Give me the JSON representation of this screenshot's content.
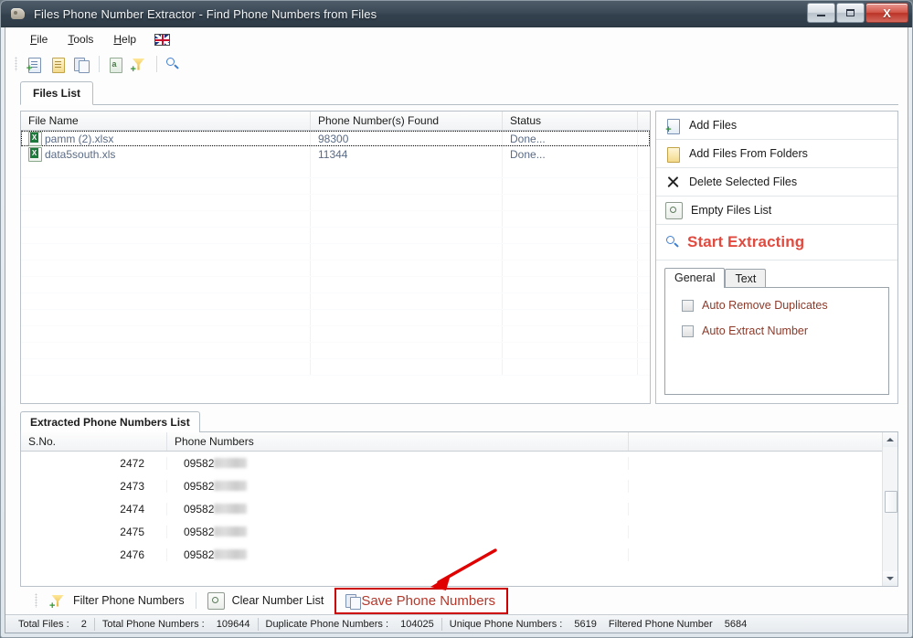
{
  "window": {
    "title": "Files Phone Number Extractor - Find Phone Numbers from Files",
    "minimize_label": "Minimize",
    "maximize_label": "Maximize",
    "close_label": "X"
  },
  "menu": {
    "items": [
      {
        "label": "File",
        "accel": "F"
      },
      {
        "label": "Tools",
        "accel": "T"
      },
      {
        "label": "Help",
        "accel": "H"
      }
    ],
    "language_icon": "uk-flag-icon"
  },
  "toolbar": {
    "buttons": [
      {
        "name": "add-files-icon",
        "tooltip": "Add Files"
      },
      {
        "name": "add-files-from-folders-icon",
        "tooltip": "Add Files From Folders"
      },
      {
        "name": "copy-icon",
        "tooltip": "Copy"
      },
      {
        "name": "extract-text-icon",
        "tooltip": "Extract Text"
      },
      {
        "name": "filter-icon",
        "tooltip": "Filter"
      },
      {
        "name": "search-icon",
        "tooltip": "Search"
      }
    ]
  },
  "files_tab": {
    "label": "Files List"
  },
  "files_grid": {
    "columns": [
      "File Name",
      "Phone Number(s) Found",
      "Status",
      ""
    ],
    "rows": [
      {
        "file_name": "pamm (2).xlsx",
        "found": "98300",
        "status": "Done...",
        "extra": ""
      },
      {
        "file_name": "data5south.xls",
        "found": "11344",
        "status": "Done...",
        "extra": ""
      }
    ],
    "empty_row_count": 13
  },
  "actions": {
    "add_files": "Add Files",
    "add_files_from_folders": "Add Files From Folders",
    "delete_selected_files": "Delete Selected Files",
    "empty_files_list": "Empty Files List",
    "start_extracting": "Start Extracting",
    "start_extracting_color": "#e04a3f"
  },
  "options": {
    "tabs": [
      {
        "label": "General",
        "active": true
      },
      {
        "label": "Text",
        "active": false
      }
    ],
    "checkboxes": [
      {
        "label": "Auto Remove Duplicates",
        "checked": false
      },
      {
        "label": "Auto Extract Number",
        "checked": false
      }
    ],
    "label_color": "#8b3a2a"
  },
  "extracted_tab": {
    "label": "Extracted Phone Numbers List"
  },
  "extracted_grid": {
    "columns": [
      "S.No.",
      "Phone Numbers",
      ""
    ],
    "rows": [
      {
        "sno": "2472",
        "number_prefix": "09582",
        "redacted": true
      },
      {
        "sno": "2473",
        "number_prefix": "09582",
        "redacted": true
      },
      {
        "sno": "2474",
        "number_prefix": "09582",
        "redacted": true
      },
      {
        "sno": "2475",
        "number_prefix": "09582",
        "redacted": true
      },
      {
        "sno": "2476",
        "number_prefix": "09582",
        "redacted": true
      }
    ]
  },
  "bottom_toolbar": {
    "filter_phone_numbers": "Filter Phone Numbers",
    "clear_number_list": "Clear Number List",
    "save_phone_numbers": "Save Phone Numbers",
    "highlight_color": "#cc0000"
  },
  "status_bar": {
    "segments": [
      {
        "label": "Total Files :",
        "value": "2"
      },
      {
        "label": "Total Phone Numbers :",
        "value": "109644"
      },
      {
        "label": "Duplicate Phone Numbers :",
        "value": "104025"
      },
      {
        "label": "Unique Phone Numbers :",
        "value": "5619"
      },
      {
        "label": "Filtered Phone Number",
        "value": "5684"
      }
    ]
  }
}
